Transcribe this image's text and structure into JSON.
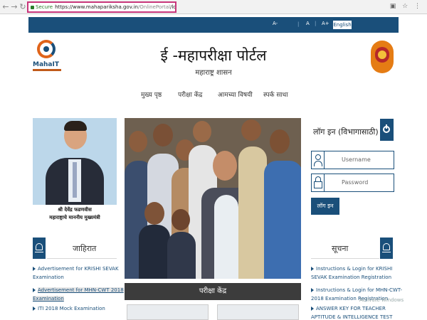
{
  "browser": {
    "secure_label": "Secure",
    "url_host": "https://www.mahapariksha.gov.in",
    "url_path": "/OnlinePortal",
    "url_rest": "/loginPage#"
  },
  "topbar": {
    "font_small": "A-",
    "font_normal": "A",
    "font_large": "A+",
    "language": "English"
  },
  "header": {
    "logo_text": "MahaIT",
    "title": "ई -महापरीक्षा पोर्टल",
    "subtitle": "महाराष्ट्र शासन"
  },
  "nav": {
    "items": [
      "मुख्य पृष्ठ",
      "परीक्षा केंद्र",
      "आमच्या विषयी",
      "स्पर्क साधा"
    ]
  },
  "profile": {
    "name": "श्री देवेंद्र फडणवीस",
    "designation": "महाराष्ट्राचे माननीय मुख्यमंत्री"
  },
  "login": {
    "title": "लॉग इन (विभागासाठी)",
    "username_placeholder": "Username",
    "password_placeholder": "Password",
    "button_label": "लॉग इन"
  },
  "ads": {
    "title": "जाहिरात",
    "items": [
      "Advertisement for KRISHI SEVAK",
      "Examination",
      "Advertisement for MHN-CWT 2018",
      "Examination",
      "ITI 2018 Mock Examination"
    ]
  },
  "notices": {
    "title": "सूचना",
    "items": [
      "Instructions & Login for KRISHI",
      "SEVAK Examination Registration",
      "Instructions & Login for MHN-CWT-",
      "2018 Examination Registration",
      "ANSWER KEY FOR TEACHER",
      "APTITUDE & INTELLIGENCE TEST"
    ]
  },
  "center": {
    "exam_centre_label": "परीक्षा केंद्र"
  },
  "watermark": "Activate Windows"
}
